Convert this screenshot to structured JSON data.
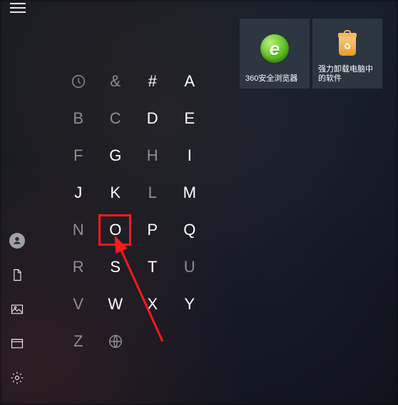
{
  "highlight_color": "#ff1a1a",
  "arrow_color": "#ff1a1a",
  "tile_bg": "rgba(60,72,84,0.55)",
  "grid": {
    "rows": [
      [
        {
          "key": "recent",
          "type": "icon",
          "dim": true
        },
        {
          "key": "amp",
          "label": "&",
          "dim": true
        },
        {
          "key": "hash",
          "label": "#"
        },
        {
          "key": "A",
          "label": "A"
        }
      ],
      [
        {
          "key": "B",
          "label": "B",
          "dim": true
        },
        {
          "key": "C",
          "label": "C",
          "dim": true
        },
        {
          "key": "D",
          "label": "D"
        },
        {
          "key": "E",
          "label": "E"
        }
      ],
      [
        {
          "key": "F",
          "label": "F",
          "dim": true
        },
        {
          "key": "G",
          "label": "G"
        },
        {
          "key": "H",
          "label": "H",
          "dim": true
        },
        {
          "key": "I",
          "label": "I"
        }
      ],
      [
        {
          "key": "J",
          "label": "J"
        },
        {
          "key": "K",
          "label": "K"
        },
        {
          "key": "L",
          "label": "L",
          "dim": true
        },
        {
          "key": "M",
          "label": "M"
        }
      ],
      [
        {
          "key": "N",
          "label": "N",
          "dim": true
        },
        {
          "key": "O",
          "label": "O",
          "highlight": true
        },
        {
          "key": "P",
          "label": "P"
        },
        {
          "key": "Q",
          "label": "Q"
        }
      ],
      [
        {
          "key": "R",
          "label": "R",
          "dim": true
        },
        {
          "key": "S",
          "label": "S"
        },
        {
          "key": "T",
          "label": "T"
        },
        {
          "key": "U",
          "label": "U",
          "dim": true
        }
      ],
      [
        {
          "key": "V",
          "label": "V",
          "dim": true
        },
        {
          "key": "W",
          "label": "W"
        },
        {
          "key": "X",
          "label": "X"
        },
        {
          "key": "Y",
          "label": "Y"
        }
      ],
      [
        {
          "key": "Z",
          "label": "Z",
          "dim": true
        },
        {
          "key": "globe",
          "type": "icon",
          "dim": true
        },
        {
          "key": "blank1",
          "type": "empty"
        },
        {
          "key": "blank2",
          "type": "empty"
        }
      ]
    ]
  },
  "tiles": [
    {
      "id": "360",
      "label": "360安全浏览器"
    },
    {
      "id": "uninstall",
      "label": "强力卸载电脑中的软件"
    }
  ],
  "leftbar": [
    {
      "id": "user"
    },
    {
      "id": "documents"
    },
    {
      "id": "pictures"
    },
    {
      "id": "file-explorer"
    },
    {
      "id": "settings"
    }
  ]
}
